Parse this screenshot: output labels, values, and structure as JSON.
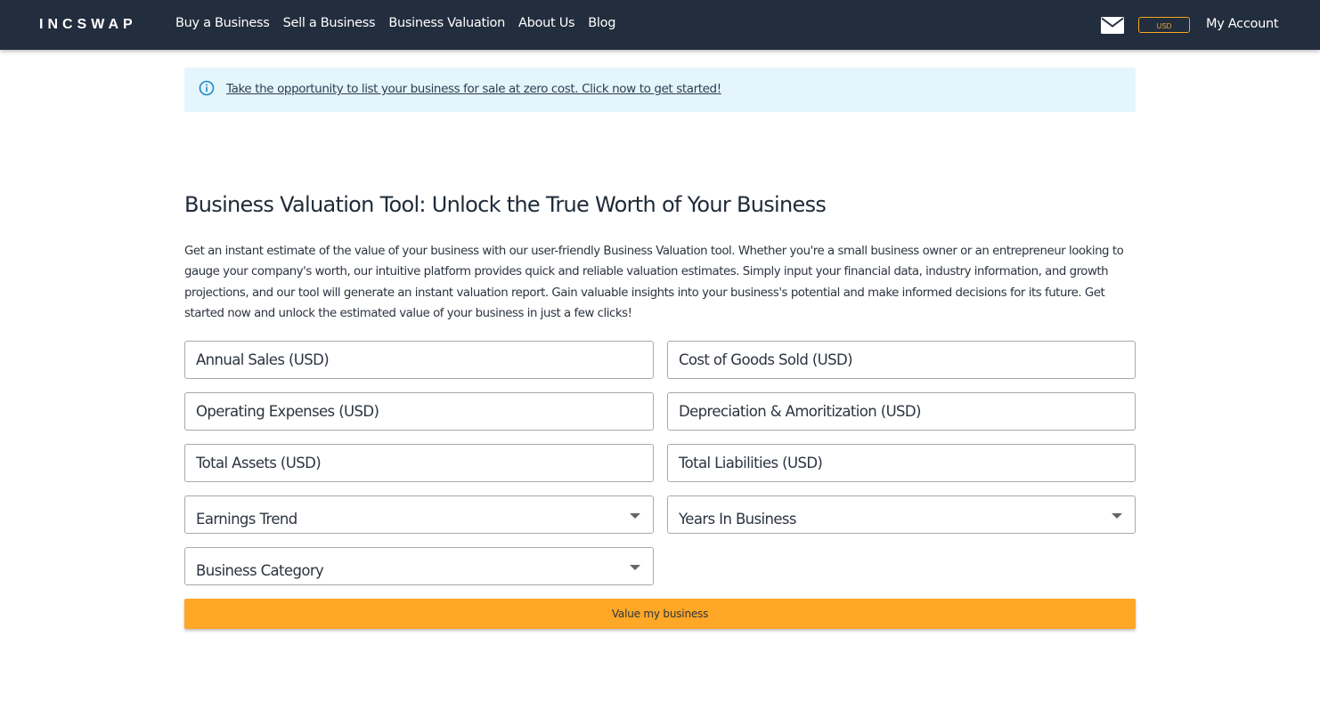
{
  "header": {
    "logo": "INCSWAP",
    "nav": [
      "Buy a Business",
      "Sell a Business",
      "Business Valuation",
      "About Us",
      "Blog"
    ],
    "currency": "USD",
    "account": "My Account",
    "mail_icon": "mail-icon"
  },
  "alert": {
    "icon": "info-icon",
    "text": "Take the opportunity to list your business for sale at zero cost. Click now to get started!"
  },
  "main": {
    "title": "Business Valuation Tool: Unlock the True Worth of Your Business",
    "intro": "Get an instant estimate of the value of your business with our user-friendly Business Valuation tool. Whether you're a small business owner or an entrepreneur looking to gauge your company's worth, our intuitive platform provides quick and reliable valuation estimates. Simply input your financial data, industry information, and growth projections, and our tool will generate an instant valuation report. Gain valuable insights into your business's potential and make informed decisions for its future. Get started now and unlock the estimated value of your business in just a few clicks!"
  },
  "form": {
    "annual_sales": "Annual Sales (USD)",
    "cogs": "Cost of Goods Sold (USD)",
    "opex": "Operating Expenses (USD)",
    "depreciation": "Depreciation & Amoritization (USD)",
    "total_assets": "Total Assets (USD)",
    "total_liabilities": "Total Liabilities (USD)",
    "earnings_trend": "Earnings Trend",
    "years_in_business": "Years In Business",
    "business_category": "Business Category",
    "submit": "Value my business"
  },
  "colors": {
    "navbar": "#222d3d",
    "accent": "#ffa726",
    "alert_bg": "#e5f5fc",
    "info": "#1e88c8"
  }
}
